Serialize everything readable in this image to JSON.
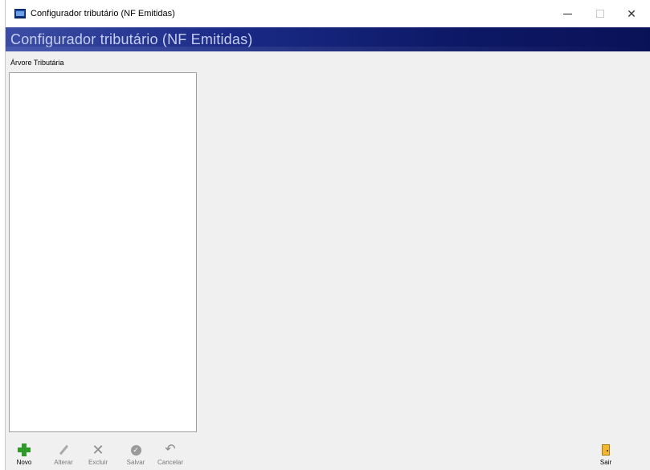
{
  "window": {
    "title": "Configurador tributário (NF Emitidas)",
    "minimize_glyph": "—",
    "close_glyph": "✕"
  },
  "header": {
    "title": "Configurador tributário (NF Emitidas)"
  },
  "tree": {
    "label": "Árvore Tributária",
    "items": []
  },
  "toolbar": {
    "novo": {
      "label": "Novo",
      "icon": "plus-icon",
      "enabled": true
    },
    "alterar": {
      "label": "Alterar",
      "icon": "pencil-icon",
      "enabled": false
    },
    "excluir": {
      "label": "Excluir",
      "icon": "x-icon",
      "enabled": false
    },
    "salvar": {
      "label": "Salvar",
      "icon": "check-icon",
      "enabled": false
    },
    "cancelar": {
      "label": "Cancelar",
      "icon": "undo-icon",
      "enabled": false
    },
    "sair": {
      "label": "Sair",
      "icon": "exit-door-icon",
      "enabled": true
    }
  },
  "colors": {
    "header_dark": "#0a1257",
    "header_light": "#3c4da5",
    "novo_green": "#2e9a2a",
    "sair_yellow": "#f2b632"
  }
}
